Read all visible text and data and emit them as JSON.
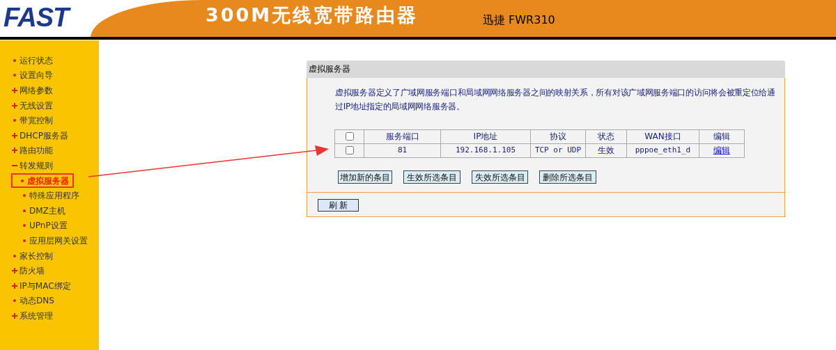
{
  "header": {
    "logo": "FAST",
    "title": "300M无线宽带路由器",
    "model": "迅捷 FWR310"
  },
  "sidebar": {
    "items": [
      {
        "label": "运行状态",
        "kind": "leaf",
        "selected": false
      },
      {
        "label": "设置向导",
        "kind": "leaf",
        "selected": false
      },
      {
        "label": "网络参数",
        "kind": "collapsed",
        "selected": false
      },
      {
        "label": "无线设置",
        "kind": "collapsed",
        "selected": false
      },
      {
        "label": "带宽控制",
        "kind": "leaf",
        "selected": false
      },
      {
        "label": "DHCP服务器",
        "kind": "collapsed",
        "selected": false
      },
      {
        "label": "路由功能",
        "kind": "collapsed",
        "selected": false
      },
      {
        "label": "转发规则",
        "kind": "expanded",
        "selected": false,
        "children": [
          {
            "label": "虚拟服务器",
            "kind": "leaf",
            "selected": true
          },
          {
            "label": "特殊应用程序",
            "kind": "leaf",
            "selected": false
          },
          {
            "label": "DMZ主机",
            "kind": "leaf",
            "selected": false
          },
          {
            "label": "UPnP设置",
            "kind": "leaf",
            "selected": false
          },
          {
            "label": "应用层网关设置",
            "kind": "leaf",
            "selected": false
          }
        ]
      },
      {
        "label": "家长控制",
        "kind": "leaf",
        "selected": false
      },
      {
        "label": "防火墙",
        "kind": "collapsed",
        "selected": false
      },
      {
        "label": "IP与MAC绑定",
        "kind": "collapsed",
        "selected": false
      },
      {
        "label": "动态DNS",
        "kind": "leaf",
        "selected": false
      },
      {
        "label": "系统管理",
        "kind": "collapsed",
        "selected": false
      }
    ]
  },
  "panel": {
    "title": "虚拟服务器",
    "description": "虚拟服务器定义了广域网服务端口和局域网网络服务器之间的映射关系，所有对该广域网服务端口的访问将会被重定位给通过IP地址指定的局域网网络服务器。",
    "table": {
      "select_all_checked": false,
      "columns": [
        "服务端口",
        "IP地址",
        "协议",
        "状态",
        "WAN接口",
        "编辑"
      ],
      "rows": [
        {
          "checked": false,
          "port": "81",
          "ip": "192.168.1.105",
          "protocol": "TCP or UDP",
          "status": "生效",
          "wan": "pppoe_eth1_d",
          "edit": "编辑"
        }
      ]
    },
    "buttons": [
      "增加新的条目",
      "生效所选条目",
      "失效所选条目",
      "删除所选条目"
    ],
    "refresh_button": "刷 新"
  }
}
